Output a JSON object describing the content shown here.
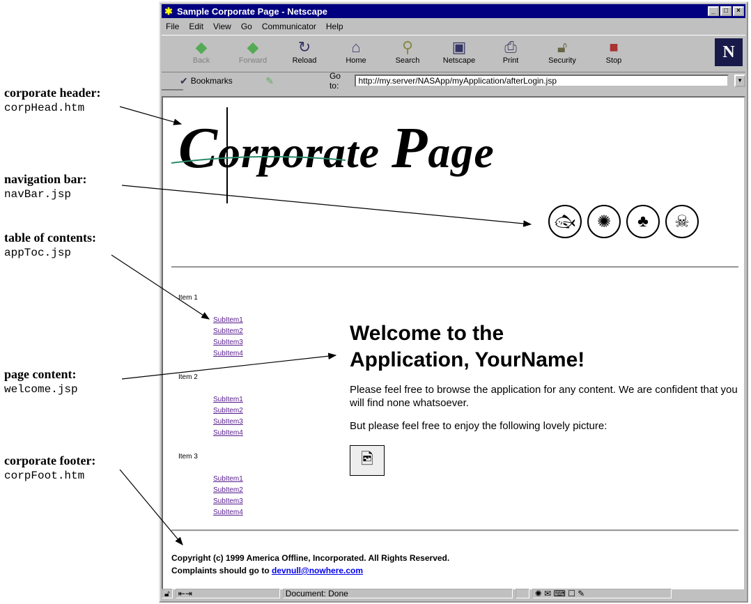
{
  "annotations": [
    {
      "title": "corporate header:",
      "file": "corpHead.htm"
    },
    {
      "title": "navigation bar:",
      "file": "navBar.jsp"
    },
    {
      "title": "table of contents:",
      "file": "appToc.jsp"
    },
    {
      "title": "page content:",
      "file": "welcome.jsp"
    },
    {
      "title": "corporate footer:",
      "file": "corpFoot.htm"
    }
  ],
  "window": {
    "title": "Sample Corporate Page - Netscape"
  },
  "menu": [
    "File",
    "Edit",
    "View",
    "Go",
    "Communicator",
    "Help"
  ],
  "toolbar": [
    {
      "label": "Back",
      "icon": "back-icon"
    },
    {
      "label": "Forward",
      "icon": "forward-icon"
    },
    {
      "label": "Reload",
      "icon": "reload-icon"
    },
    {
      "label": "Home",
      "icon": "home-icon"
    },
    {
      "label": "Search",
      "icon": "search-icon"
    },
    {
      "label": "Netscape",
      "icon": "netscape-icon"
    },
    {
      "label": "Print",
      "icon": "print-icon"
    },
    {
      "label": "Security",
      "icon": "security-icon"
    },
    {
      "label": "Stop",
      "icon": "stop-icon"
    }
  ],
  "location": {
    "bookmarks": "Bookmarks",
    "goto": "Go to:",
    "url": "http://my.server/NASApp/myApplication/afterLogin.jsp"
  },
  "page": {
    "logo": {
      "first": "C",
      "rest": "orporate ",
      "first2": "P",
      "rest2": "age"
    },
    "toc": [
      {
        "label": "Item 1",
        "subs": [
          "SubItem1",
          "SubItem2",
          "SubItem3",
          "SubItem4"
        ]
      },
      {
        "label": "Item 2",
        "subs": [
          "SubItem1",
          "SubItem2",
          "SubItem3",
          "SubItem4"
        ]
      },
      {
        "label": "Item 3",
        "subs": [
          "SubItem1",
          "SubItem2",
          "SubItem3",
          "SubItem4"
        ]
      }
    ],
    "heading1": "Welcome to the",
    "heading2": "Application, YourName!",
    "para1": "Please feel free to browse the application for any content. We are confident that you will find none whatsoever.",
    "para2": "But please feel free to enjoy the following lovely picture:",
    "footer1": "Copyright (c) 1999 America Offline, Incorporated. All Rights Reserved.",
    "footer2_prefix": "Complaints should go to ",
    "footer_email": "devnull@nowhere.com"
  },
  "status": {
    "text": "Document: Done"
  }
}
